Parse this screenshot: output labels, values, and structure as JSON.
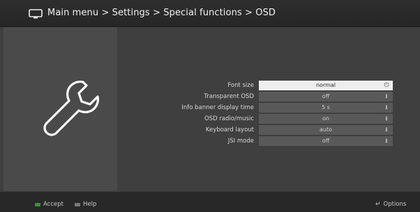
{
  "header": {
    "breadcrumb": "Main menu > Settings > Special functions > OSD"
  },
  "settings": [
    {
      "label": "Font size",
      "value": "normal",
      "selected": true
    },
    {
      "label": "Transparent OSD",
      "value": "off",
      "selected": false
    },
    {
      "label": "Info banner display time",
      "value": "5 s",
      "selected": false
    },
    {
      "label": "OSD radio/music",
      "value": "on",
      "selected": false
    },
    {
      "label": "Keyboard layout",
      "value": "auto",
      "selected": false
    },
    {
      "label": "JSI mode",
      "value": "off",
      "selected": false
    }
  ],
  "footer": {
    "accept_label": "Accept",
    "help_label": "Help",
    "options_label": "Options"
  },
  "icons": {
    "header": "tv-icon",
    "side_panel": "wrench-icon",
    "selected_arrow": "power-toggle-icon",
    "row_arrow": "dropdown-arrow-icon"
  },
  "colors": {
    "selected_row_bg": "#eeeeee",
    "value_bg": "#595959",
    "accept_key": "#3e8e3e"
  }
}
